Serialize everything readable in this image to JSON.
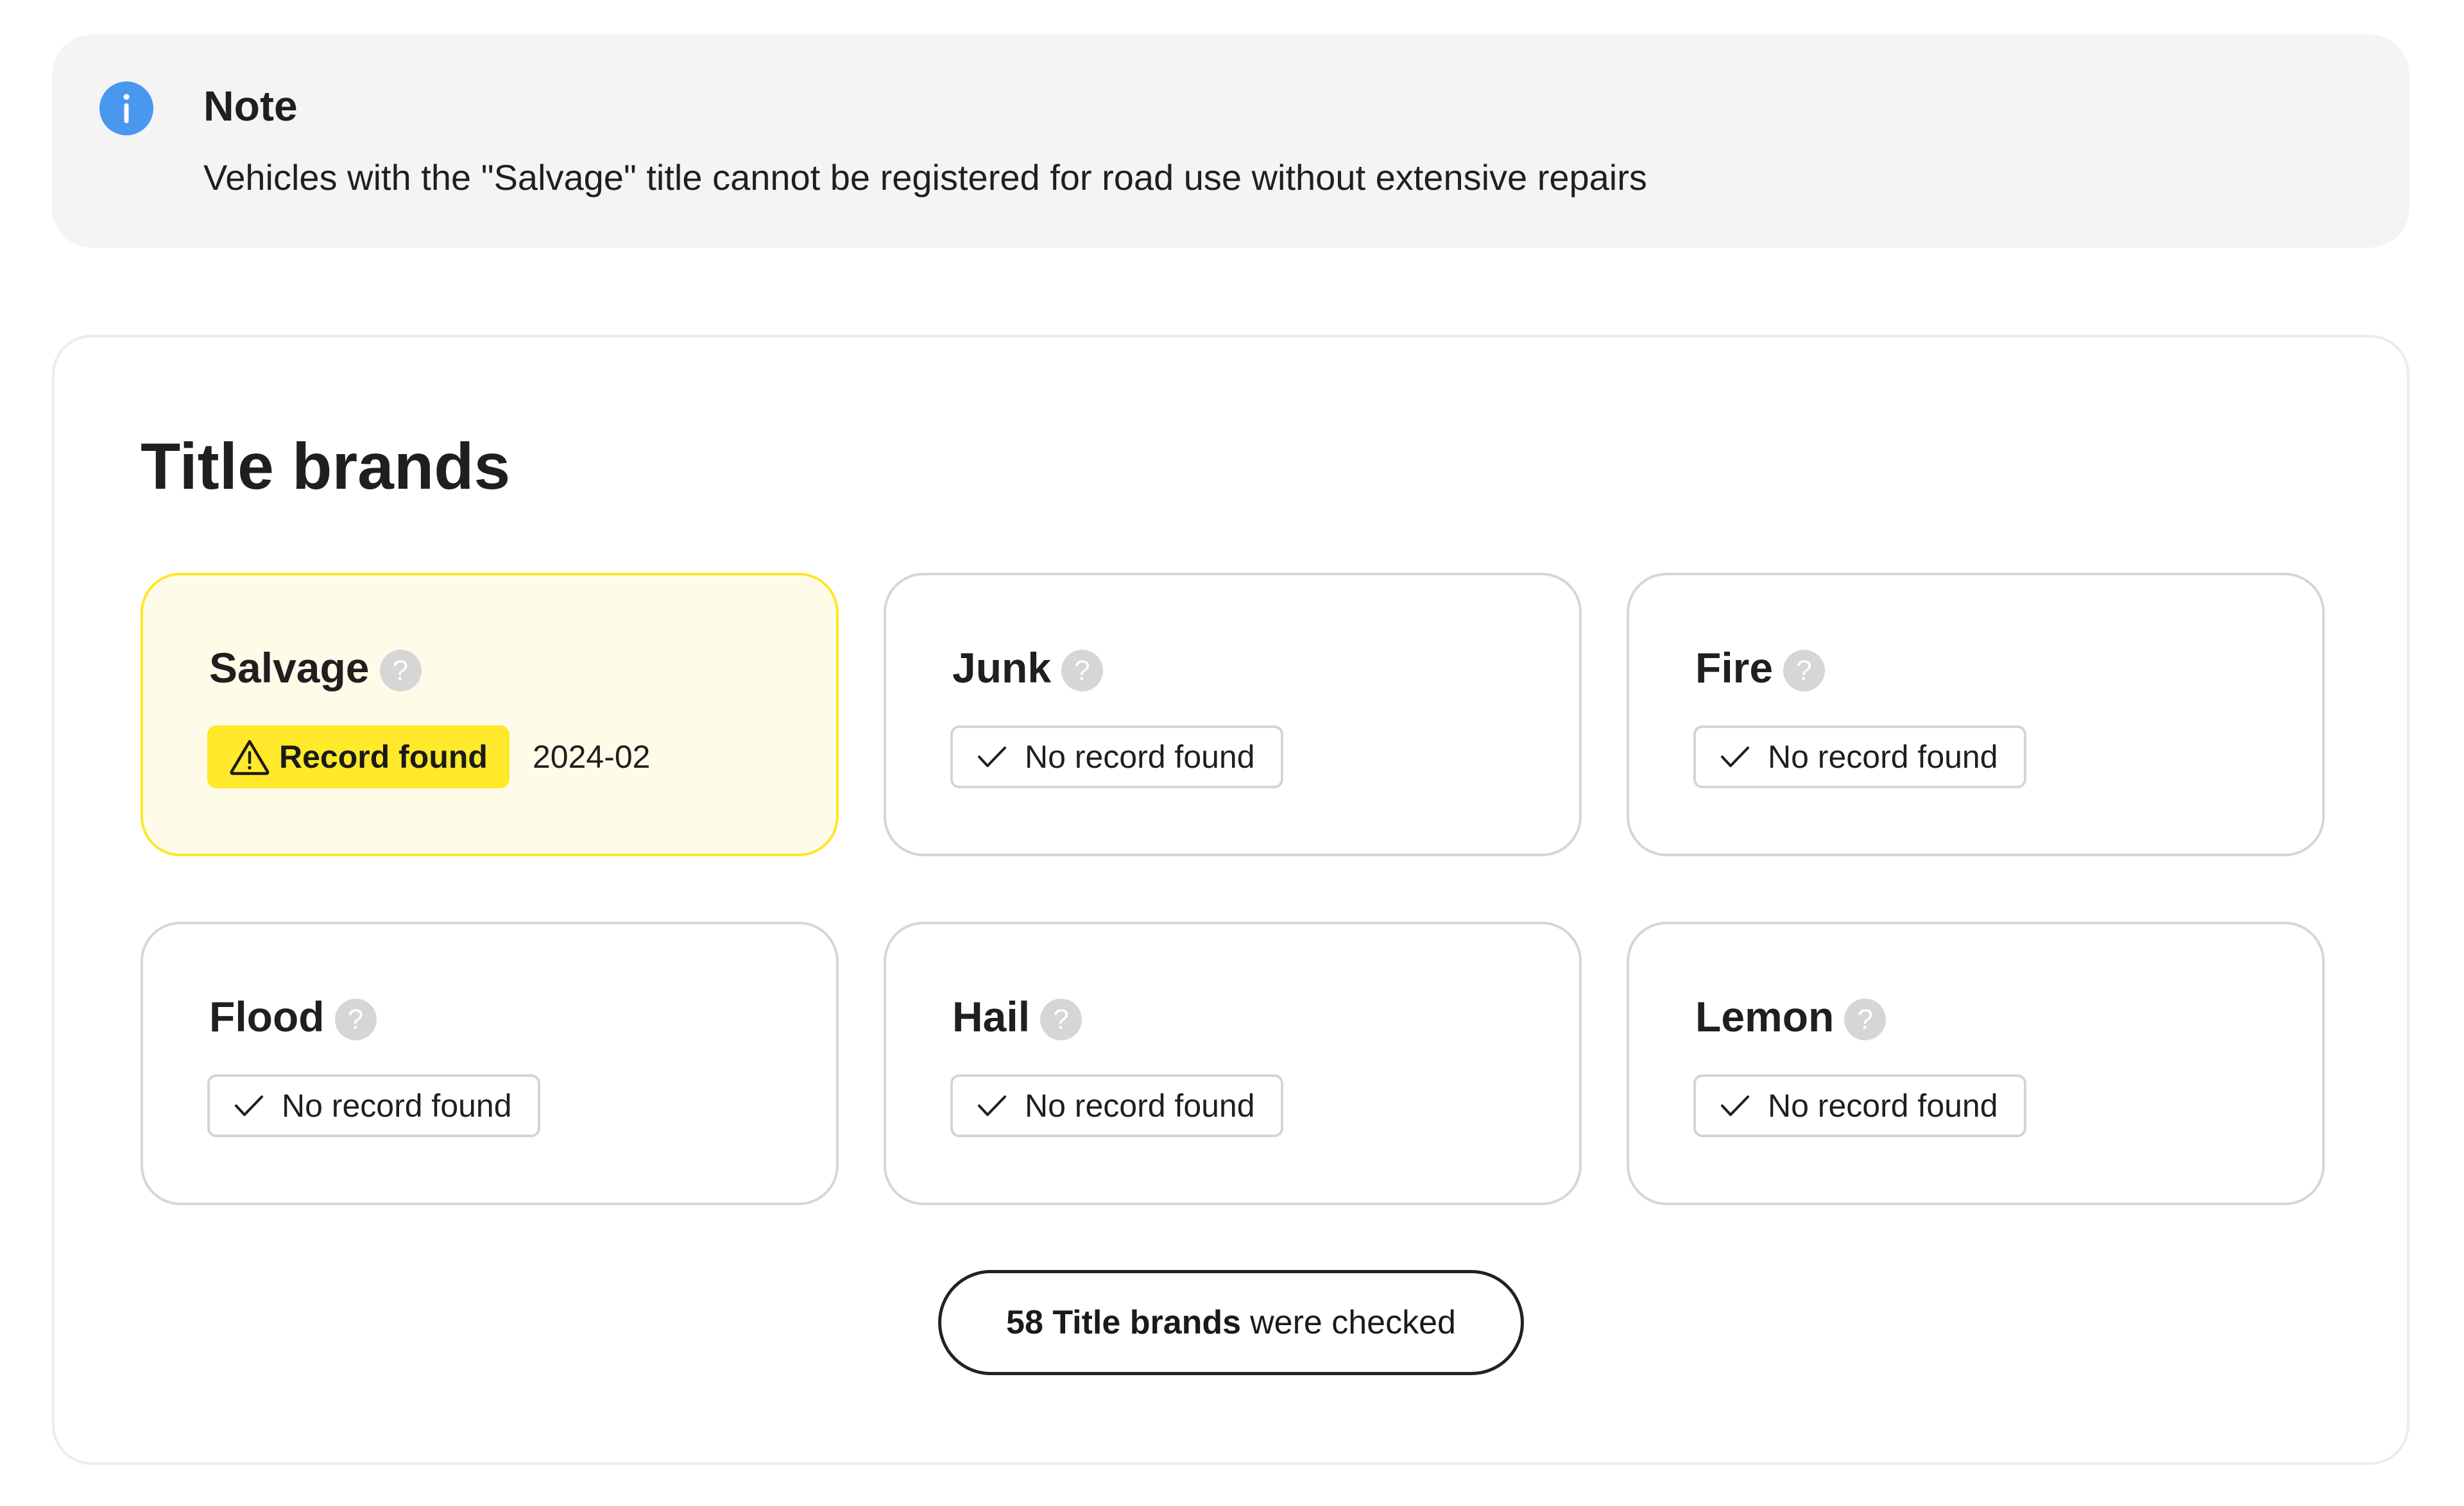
{
  "note": {
    "icon": "info-icon",
    "title": "Note",
    "text": "Vehicles with the \"Salvage\" title cannot be registered for road use without extensive repairs",
    "accent_color": "#4a97f0"
  },
  "panel": {
    "title": "Title brands",
    "brands": [
      {
        "name": "Salvage",
        "help_icon": "question-icon",
        "help_glyph": "?",
        "status": "found",
        "status_label": "Record found",
        "status_icon": "warning-icon",
        "date": "2024-02"
      },
      {
        "name": "Junk",
        "help_icon": "question-icon",
        "help_glyph": "?",
        "status": "none",
        "status_label": "No record found",
        "status_icon": "check-icon"
      },
      {
        "name": "Fire",
        "help_icon": "question-icon",
        "help_glyph": "?",
        "status": "none",
        "status_label": "No record found",
        "status_icon": "check-icon"
      },
      {
        "name": "Flood",
        "help_icon": "question-icon",
        "help_glyph": "?",
        "status": "none",
        "status_label": "No record found",
        "status_icon": "check-icon"
      },
      {
        "name": "Hail",
        "help_icon": "question-icon",
        "help_glyph": "?",
        "status": "none",
        "status_label": "No record found",
        "status_icon": "check-icon"
      },
      {
        "name": "Lemon",
        "help_icon": "question-icon",
        "help_glyph": "?",
        "status": "none",
        "status_label": "No record found",
        "status_icon": "check-icon"
      }
    ],
    "checked_button": {
      "count_label": "58 Title brands",
      "suffix": "were checked"
    },
    "colors": {
      "found_badge": "#ffe92a",
      "found_card_bg": "#fffbe9",
      "found_card_border": "#fde726"
    }
  }
}
